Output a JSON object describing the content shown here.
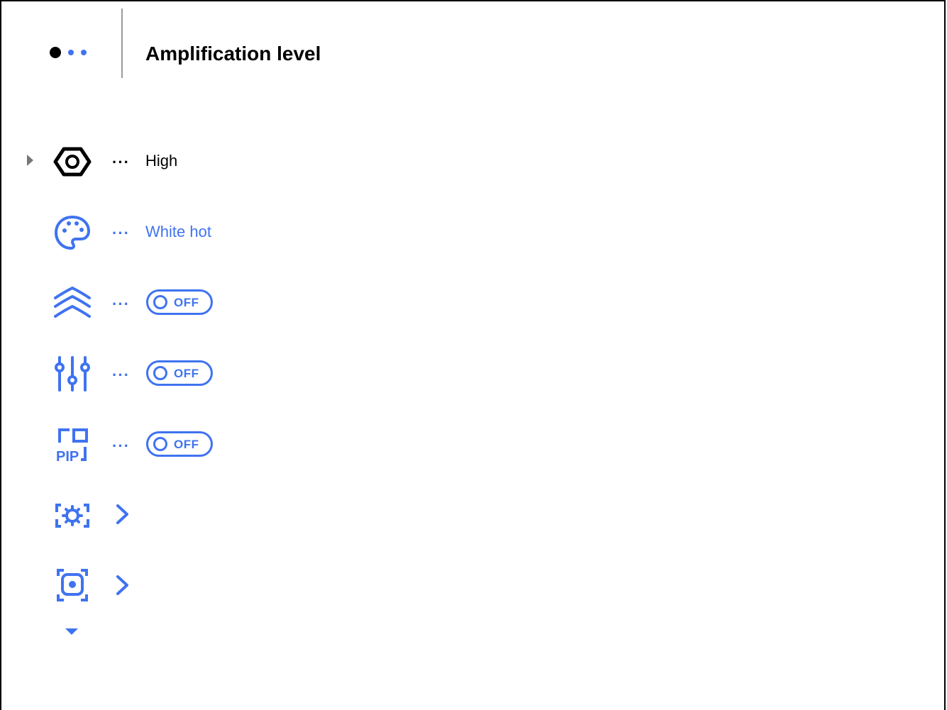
{
  "header": {
    "title": "Amplification level"
  },
  "rows": [
    {
      "icon": "amplification-hexagon-icon",
      "value": "High",
      "selected": true
    },
    {
      "icon": "palette-icon",
      "value": "White hot"
    },
    {
      "icon": "waves-icon",
      "toggle": "OFF"
    },
    {
      "icon": "sliders-icon",
      "toggle": "OFF"
    },
    {
      "icon": "pip-icon",
      "toggle": "OFF"
    },
    {
      "icon": "settings-frame-icon",
      "submenu": true
    },
    {
      "icon": "focus-frame-icon",
      "submenu": true
    }
  ],
  "ellipsis": "···",
  "colors": {
    "accent": "#3f73f0",
    "text": "#000000"
  }
}
